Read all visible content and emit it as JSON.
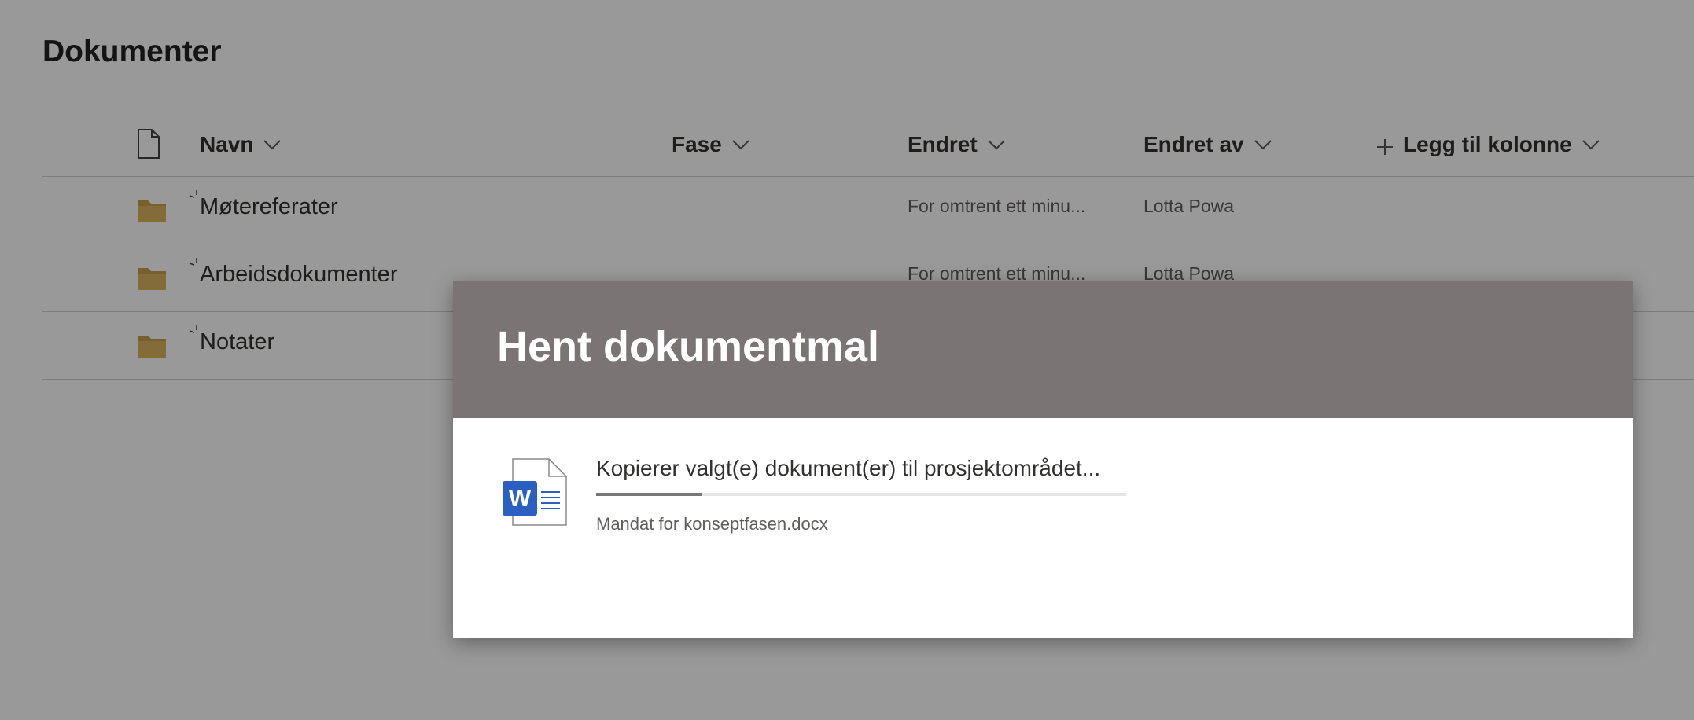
{
  "page": {
    "title": "Dokumenter"
  },
  "columns": {
    "name": "Navn",
    "phase": "Fase",
    "modified": "Endret",
    "modified_by": "Endret av",
    "add_column": "Legg til kolonne"
  },
  "rows": [
    {
      "name": "Møtereferater",
      "modified": "For omtrent ett minu...",
      "modified_by": "Lotta Powa",
      "icon": "folder-icon"
    },
    {
      "name": "Arbeidsdokumenter",
      "modified": "For omtrent ett minu...",
      "modified_by": "Lotta Powa",
      "icon": "folder-icon"
    },
    {
      "name": "Notater",
      "modified": "",
      "modified_by": "",
      "icon": "folder-icon"
    }
  ],
  "dialog": {
    "title": "Hent dokumentmal",
    "status": "Kopierer valgt(e) dokument(er) til prosjektområdet...",
    "file": "Mandat for konseptfasen.docx",
    "progress": 0.2,
    "icon": "word-document-icon"
  },
  "colors": {
    "dialog_header": "#7a7574",
    "folder": "#dcb55e",
    "word_blue": "#2b5fc1",
    "progress_fill": "#777777"
  }
}
